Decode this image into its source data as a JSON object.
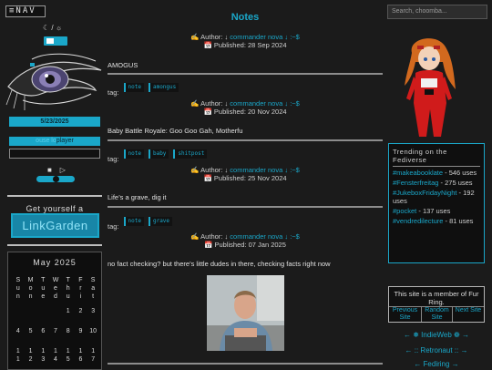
{
  "nav": {
    "label": "≡NAV"
  },
  "theme": {
    "moon": "☾",
    "sep": "/",
    "sun": "☼"
  },
  "sidebar": {
    "date": "5/23/2025",
    "player_label_dim": "ouse lo",
    "player_label": "player",
    "player_stop": "■",
    "player_play": "▷",
    "linkgarden_caption": "Get yourself a",
    "linkgarden_button": "LinkGarden"
  },
  "calendar": {
    "title": "May 2025",
    "weekdays": [
      [
        "S",
        "u",
        "n"
      ],
      [
        "M",
        "o",
        "n"
      ],
      [
        "T",
        "u",
        "e"
      ],
      [
        "W",
        "e",
        "d"
      ],
      [
        "T",
        "h",
        "u"
      ],
      [
        "F",
        "r",
        "i"
      ],
      [
        "S",
        "a",
        "t"
      ]
    ],
    "row1": [
      "",
      "",
      "",
      "",
      "1",
      "2",
      "3"
    ],
    "row2": [
      "4",
      "5",
      "6",
      "7",
      "8",
      "9",
      "10"
    ],
    "row3": [
      "11",
      "12",
      "13",
      "14",
      "15",
      "16",
      "17"
    ]
  },
  "search": {
    "placeholder": "Search, choomba..."
  },
  "page": {
    "title": "Notes"
  },
  "posts": [
    {
      "author_prefix": "✍ Author: ↓",
      "author": "commander",
      "author2": "nova",
      "author_suffix": "↓ :~$",
      "published": "📅 Published: 28 Sep 2024",
      "body": "AMOGUS",
      "tags": [
        "note",
        "amongus"
      ]
    },
    {
      "author_prefix": "✍ Author: ↓",
      "author": "commander",
      "author2": "nova",
      "author_suffix": "↓ :~$",
      "published": "📅 Published: 20 Nov 2024",
      "body": "Baby Battle Royale: Goo Goo Gah, Motherfu",
      "tags": [
        "note",
        "baby",
        "shitpost"
      ]
    },
    {
      "author_prefix": "✍ Author: ↓",
      "author": "commander",
      "author2": "nova",
      "author_suffix": "↓ :~$",
      "published": "📅 Published: 25 Nov 2024",
      "body": "Life’s a grave, dig it",
      "tags": [
        "note",
        "grave"
      ]
    },
    {
      "author_prefix": "✍ Author: ↓",
      "author": "commander",
      "author2": "nova",
      "author_suffix": "↓ :~$",
      "published": "📅 Published: 07 Jan 2025",
      "body": "no fact checking? but there’s little dudes in there, checking facts right now",
      "tags": []
    }
  ],
  "tag_label": "tag:",
  "trending": {
    "title": "Trending on the Fediverse",
    "items": [
      {
        "tag": "#makeabooklate",
        "text": " - 546 uses"
      },
      {
        "tag": "#Fensterfreitag",
        "text": " - 275 uses"
      },
      {
        "tag": "#JukeboxFridayNight",
        "text": " - 192 uses"
      },
      {
        "tag": "#pocket",
        "text": " - 137 uses"
      },
      {
        "tag": "#vendredilecture",
        "text": " - 81 uses"
      }
    ]
  },
  "fur_ring": {
    "caption": "This site is a member of Fur Ring.",
    "prev": "Previous Site",
    "random": "Random Site",
    "next": "Next Site"
  },
  "webrings": [
    "← ❅ IndieWeb ❁ →",
    "← :: Retronaut :: →",
    "← Fediring →"
  ],
  "colors": {
    "accent": "#1aa7c9",
    "background": "#1b1b1b"
  }
}
